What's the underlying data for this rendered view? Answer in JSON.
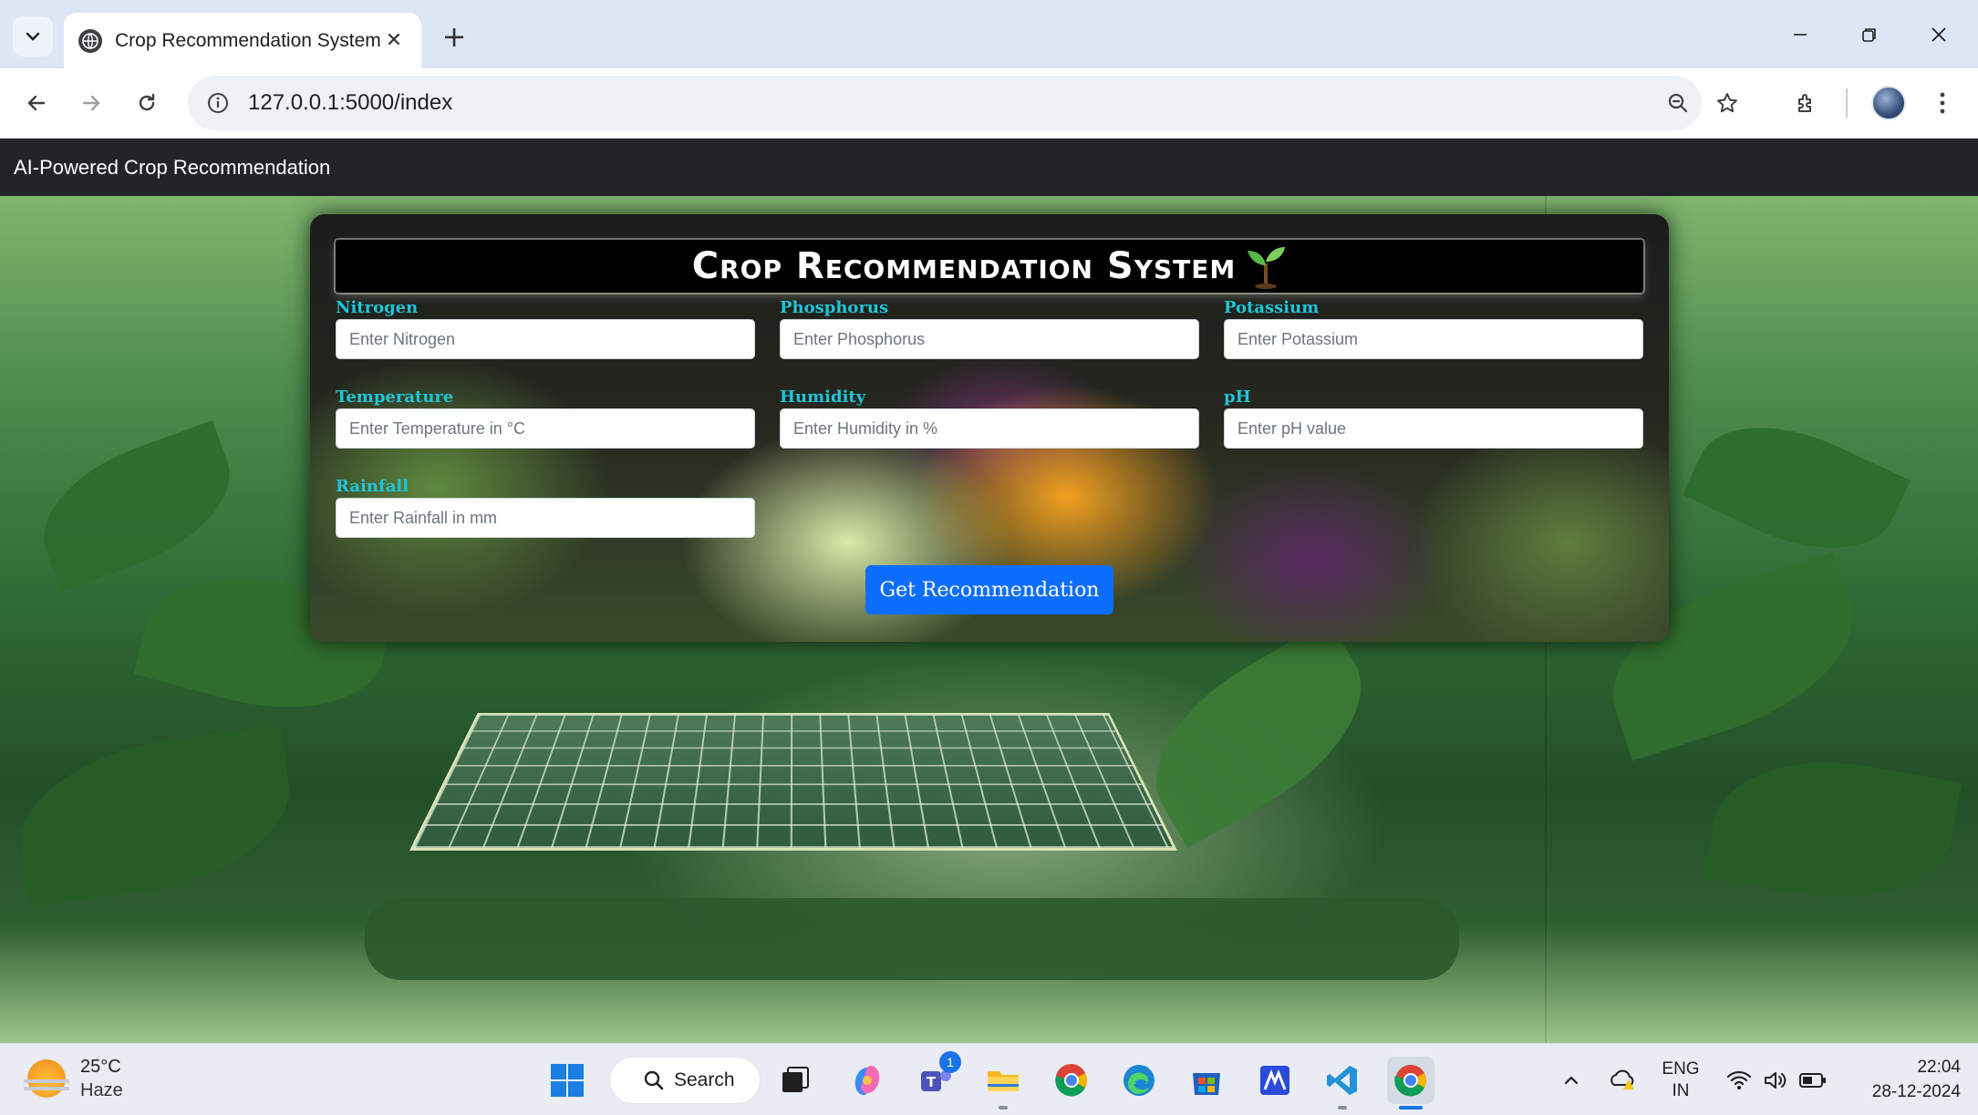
{
  "browser": {
    "tab_title": "Crop Recommendation System",
    "url": "127.0.0.1:5000/index",
    "new_tab_glyph": "+"
  },
  "app": {
    "brand": "AI-Powered Crop Recommendation",
    "heading": "Crop Recommendation System",
    "submit_label": "Get Recommendation",
    "fields": [
      {
        "label": "Nitrogen",
        "placeholder": "Enter Nitrogen",
        "value": ""
      },
      {
        "label": "Phosphorus",
        "placeholder": "Enter Phosphorus",
        "value": ""
      },
      {
        "label": "Potassium",
        "placeholder": "Enter Potassium",
        "value": ""
      },
      {
        "label": "Temperature",
        "placeholder": "Enter Temperature in °C",
        "value": ""
      },
      {
        "label": "Humidity",
        "placeholder": "Enter Humidity in %",
        "value": ""
      },
      {
        "label": "pH",
        "placeholder": "Enter pH value",
        "value": ""
      },
      {
        "label": "Rainfall",
        "placeholder": "Enter Rainfall in mm",
        "value": ""
      }
    ],
    "colors": {
      "label": "#1fc6d9",
      "button": "#0d6efd",
      "navbar": "#212529"
    }
  },
  "taskbar": {
    "weather_temp": "25°C",
    "weather_condition": "Haze",
    "search_label": "Search",
    "teams_badge": "1",
    "language_line1": "ENG",
    "language_line2": "IN",
    "time": "22:04",
    "date": "28-12-2024"
  }
}
